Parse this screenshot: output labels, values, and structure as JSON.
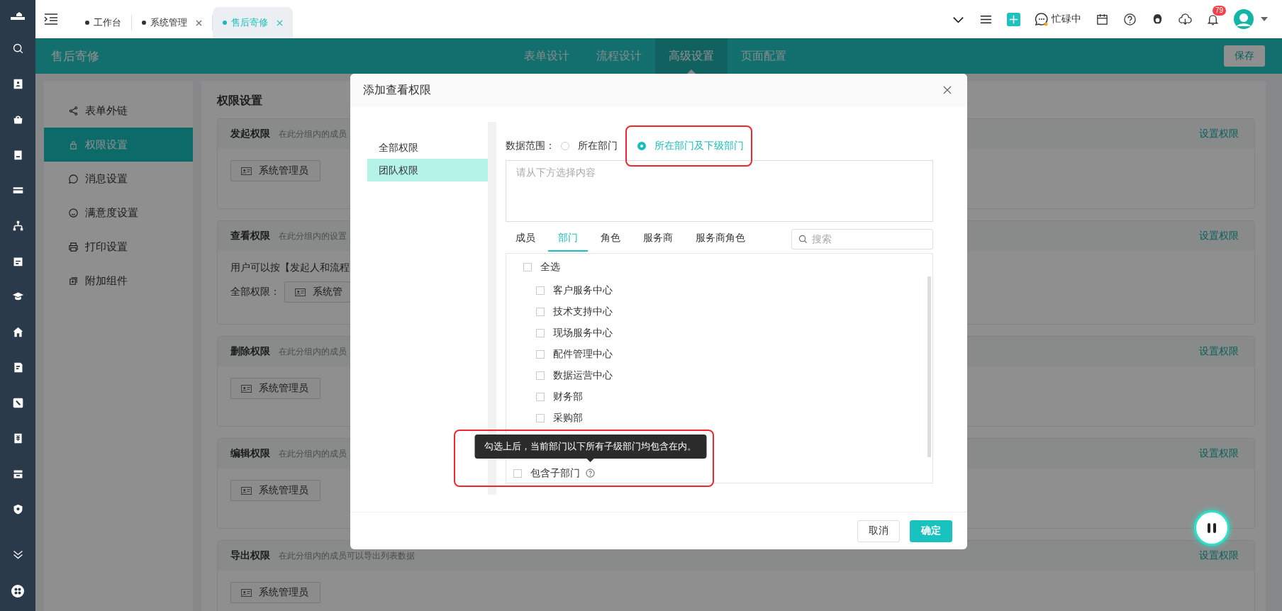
{
  "top_tabs": [
    {
      "label": "工作台",
      "selected": false,
      "closable": false
    },
    {
      "label": "系统管理",
      "selected": false,
      "closable": true
    },
    {
      "label": "售后寄修",
      "selected": true,
      "closable": true
    }
  ],
  "status": {
    "label": "忙碌中"
  },
  "notifications": {
    "badge": "79"
  },
  "app_header": {
    "title": "售后寄修",
    "tabs": [
      {
        "label": "表单设计",
        "selected": false
      },
      {
        "label": "流程设计",
        "selected": false
      },
      {
        "label": "高级设置",
        "selected": true
      },
      {
        "label": "页面配置",
        "selected": false
      }
    ],
    "save": "保存"
  },
  "settings_menu": [
    {
      "label": "表单外链",
      "selected": false
    },
    {
      "label": "权限设置",
      "selected": true
    },
    {
      "label": "消息设置",
      "selected": false
    },
    {
      "label": "满意度设置",
      "selected": false
    },
    {
      "label": "打印设置",
      "selected": false
    },
    {
      "label": "附加组件",
      "selected": false
    }
  ],
  "main": {
    "title": "权限设置",
    "sections": [
      {
        "title": "发起权限",
        "description": "在此分组内的成员",
        "action": "设置权限",
        "members": [
          "系统管理员"
        ]
      },
      {
        "title": "查看权限",
        "description": "在此分组内的设置",
        "action": "设置权限",
        "note": "用户可以按【发起人和流程",
        "scope_label": "全部权限：",
        "members": [
          "系统管"
        ]
      },
      {
        "title": "删除权限",
        "description": "在此分组内的成员",
        "action": "设置权限",
        "members": [
          "系统管理员"
        ]
      },
      {
        "title": "编辑权限",
        "description": "在此分组内的成员",
        "action": "设置权限",
        "members": [
          "系统管理员"
        ]
      },
      {
        "title": "导出权限",
        "description": "在此分组内的成员可以导出列表数据",
        "action": "设置权限",
        "members": [
          "系统管理员"
        ]
      }
    ]
  },
  "modal": {
    "title": "添加查看权限",
    "scope_menu": [
      {
        "label": "全部权限",
        "selected": false
      },
      {
        "label": "团队权限",
        "selected": true
      }
    ],
    "range_label": "数据范围：",
    "range_options": [
      {
        "label": "所在部门",
        "selected": false,
        "highlighted": false
      },
      {
        "label": "所在部门及下级部门",
        "selected": true,
        "highlighted": true
      }
    ],
    "selection_placeholder": "请从下方选择内容",
    "tabs": [
      {
        "label": "成员",
        "selected": false
      },
      {
        "label": "部门",
        "selected": true
      },
      {
        "label": "角色",
        "selected": false
      },
      {
        "label": "服务商",
        "selected": false
      },
      {
        "label": "服务商角色",
        "selected": false
      }
    ],
    "search_placeholder": "搜索",
    "select_all": {
      "label": "全选",
      "checked": false
    },
    "departments": [
      {
        "label": "客户服务中心",
        "checked": false
      },
      {
        "label": "技术支持中心",
        "checked": false
      },
      {
        "label": "现场服务中心",
        "checked": false
      },
      {
        "label": "配件管理中心",
        "checked": false
      },
      {
        "label": "数据运营中心",
        "checked": false
      },
      {
        "label": "财务部",
        "checked": false
      },
      {
        "label": "采购部",
        "checked": false
      }
    ],
    "include_sub": {
      "label": "包含子部门",
      "checked": false,
      "highlighted": true
    },
    "tooltip": "勾选上后，当前部门以下所有子级部门均包含在内。",
    "cancel": "取消",
    "confirm": "确定"
  }
}
